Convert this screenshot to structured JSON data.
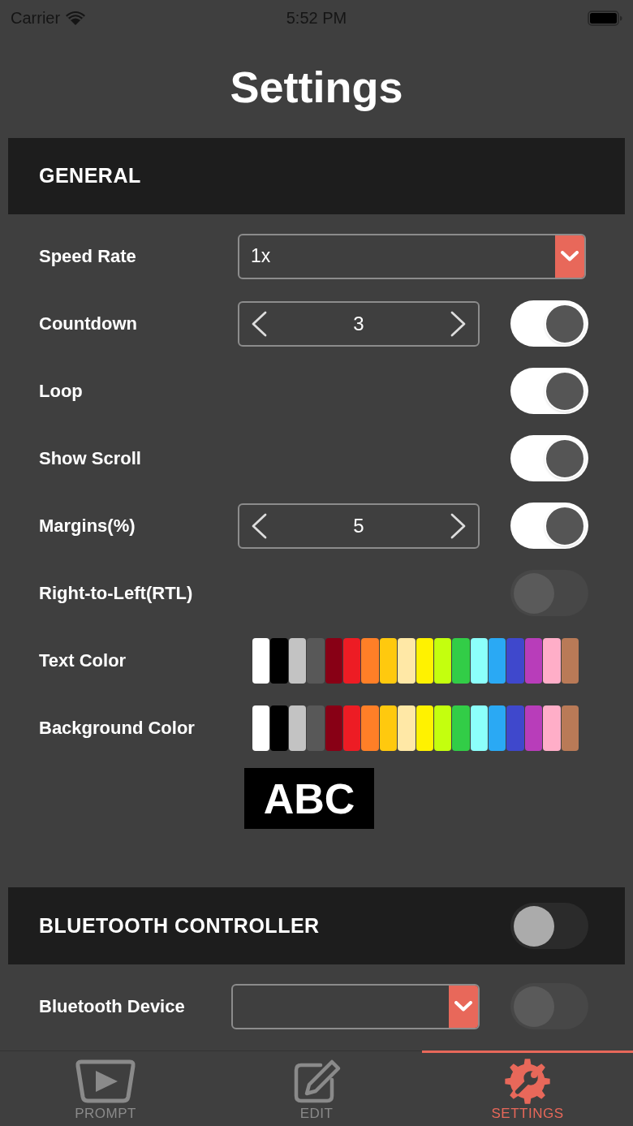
{
  "status_bar": {
    "carrier": "Carrier",
    "time": "5:52 PM"
  },
  "title": "Settings",
  "general": {
    "header": "GENERAL",
    "rows": [
      {
        "kind": "dropdown",
        "label": "Speed Rate",
        "value": "1x"
      },
      {
        "kind": "stepper",
        "label": "Countdown",
        "value": "3",
        "toggle": {
          "on": true,
          "disabled": false
        }
      },
      {
        "kind": "toggle",
        "label": "Loop",
        "toggle": {
          "on": true,
          "disabled": false
        }
      },
      {
        "kind": "toggle",
        "label": "Show Scroll",
        "toggle": {
          "on": true,
          "disabled": false
        }
      },
      {
        "kind": "stepper",
        "label": "Margins(%)",
        "value": "5",
        "toggle": {
          "on": true,
          "disabled": false
        }
      },
      {
        "kind": "toggle",
        "label": "Right-to-Left(RTL)",
        "toggle": {
          "on": false,
          "disabled": true
        }
      },
      {
        "kind": "colors",
        "label": "Text Color",
        "swatches": [
          {
            "color": "#ffffff"
          },
          {
            "color": "#000000"
          },
          {
            "color": "#c3c3c3"
          },
          {
            "color": "#585858"
          },
          {
            "color": "#880015"
          },
          {
            "color": "#ed1c24"
          },
          {
            "color": "#ff7f27"
          },
          {
            "color": "#ffc90e"
          },
          {
            "color": "#ffe8a6"
          },
          {
            "color": "#fff200"
          },
          {
            "color": "#c4ff0e"
          },
          {
            "color": "#32cd47"
          },
          {
            "color": "#8cfffb"
          },
          {
            "color": "#2aa9f4"
          },
          {
            "color": "#3f48cc"
          },
          {
            "color": "#b83dba"
          },
          {
            "color": "#ffaec8"
          },
          {
            "color": "#b97a57"
          }
        ]
      },
      {
        "kind": "colors",
        "label": "Background Color",
        "swatches": [
          {
            "color": "#ffffff"
          },
          {
            "color": "#000000"
          },
          {
            "color": "#c3c3c3"
          },
          {
            "color": "#585858"
          },
          {
            "color": "#880015"
          },
          {
            "color": "#ed1c24"
          },
          {
            "color": "#ff7f27"
          },
          {
            "color": "#ffc90e"
          },
          {
            "color": "#ffe8a6"
          },
          {
            "color": "#fff200"
          },
          {
            "color": "#c4ff0e"
          },
          {
            "color": "#32cd47"
          },
          {
            "color": "#8cfffb"
          },
          {
            "color": "#2aa9f4"
          },
          {
            "color": "#3f48cc"
          },
          {
            "color": "#b83dba"
          },
          {
            "color": "#ffaec8"
          },
          {
            "color": "#b97a57"
          }
        ]
      }
    ],
    "preview": {
      "text": "ABC"
    }
  },
  "bluetooth": {
    "header": "BLUETOOTH CONTROLLER",
    "toggle": {
      "on": false,
      "disabled": false
    },
    "rows": [
      {
        "kind": "dropdown",
        "label": "Bluetooth Device",
        "toggle": {
          "on": false,
          "disabled": true
        }
      }
    ]
  },
  "tabs": [
    {
      "label": "PROMPT",
      "selected": false
    },
    {
      "label": "EDIT",
      "selected": false
    },
    {
      "label": "SETTINGS",
      "selected": true
    }
  ]
}
